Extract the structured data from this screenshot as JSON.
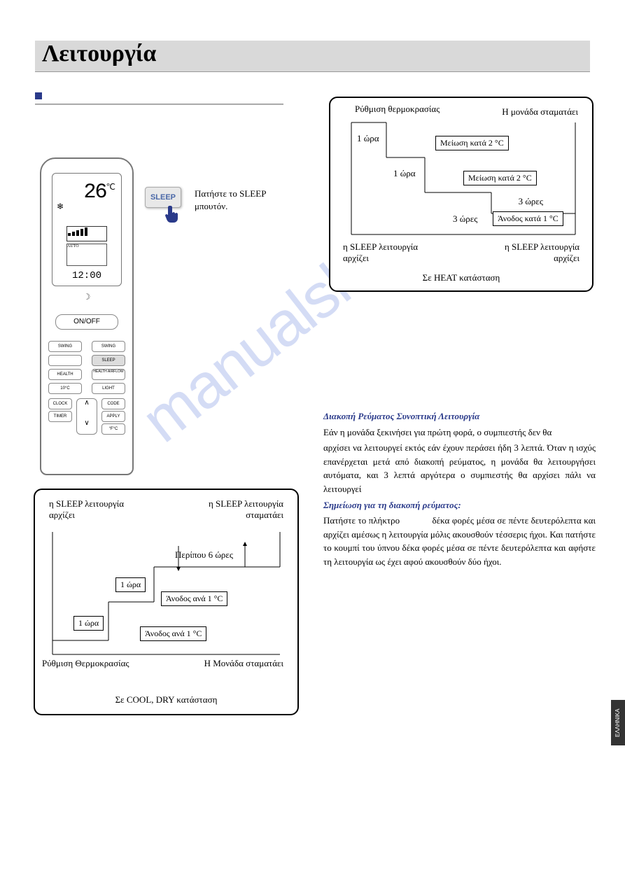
{
  "header": {
    "title": "Λειτουργία"
  },
  "remote": {
    "temp": "26",
    "temp_unit": "℃",
    "clock": "12:00",
    "onoff": "ON/OFF",
    "buttons": {
      "swing_l": "SWING",
      "swing_r": "SWING",
      "blank": "",
      "sleep": "SLEEP",
      "health": "HEALTH",
      "airflow": "HEALTH AIRFLOW",
      "tenc": "10°C",
      "light": "LIGHT",
      "clock": "CLOCK",
      "code": "CODE",
      "timer": "TIMER",
      "apply": "APPLY",
      "deg": "°F°C"
    }
  },
  "sleep_button": {
    "label": "SLEEP",
    "instruction": "Πατήστε το SLEEP μπουτόν."
  },
  "diagram_heat": {
    "temp_setting": "Ρύθμιση θερμοκρασίας",
    "unit_stops": "Η μονάδα σταματάει",
    "h1": "1 ώρα",
    "h2": "1 ώρα",
    "h3": "3 ώρες",
    "h3b": "3 ώρες",
    "dec1": "Μείωση κατά 2 °C",
    "dec2": "Μείωση κατά 2 °C",
    "inc": "Άνοδος κατά 1 °C",
    "sleep_start_l": "η SLEEP λειτουργία αρχίζει",
    "sleep_start_r": "η SLEEP λειτουργία αρχίζει",
    "mode": "Σε HEAT κατάσταση"
  },
  "diagram_cool": {
    "sleep_start": "η SLEEP λειτουργία αρχίζει",
    "sleep_stop": "η SLEEP λειτουργία σταματάει",
    "approx6": "Περίπου 6 ώρες",
    "h1": "1 ώρα",
    "h2": "1 ώρα",
    "inc1": "Άνοδος ανά 1 °C",
    "inc2": "Άνοδος ανά 1 °C",
    "temp_setting": "Ρύθμιση Θερμοκρασίας",
    "unit_stops": "Η Μονάδα σταματάει",
    "mode": "Σε COOL, DRY κατάσταση"
  },
  "text": {
    "power_h": "Διακοπή Ρεύματος Συνοπτική Λειτουργία",
    "p1": "Εάν η μονάδα ξεκινήσει για πρώτη φορά, ο συμπιεστής δεν θα",
    "p2": "αρχίσει να λειτουργεί εκτός εάν έχουν περάσει ήδη 3 λεπτά. Όταν η ισχύς επανέρχεται μετά από διακοπή ρεύματος, η μονάδα θα λειτουργήσει αυτόματα, και 3 λεπτά αργότερα ο συμπιεστής θα αρχίσει πάλι να λειτουργεί",
    "note_h": "Σημείωση για τη διακοπή ρεύματος:",
    "note_p": "Πατήστε το πλήκτρο             δέκα φορές μέσα σε πέντε δευτερόλεπτα και αρχίζει αμέσως η λειτουργία μόλις ακουσθούν τέσσερις ήχοι. Και πατήστε το κουμπί του ύπνου δέκα φορές μέσα σε πέντε δευτερόλεπτα και αφήστε τη λειτουργία ως έχει αφού ακουσθούν δύο ήχοι."
  },
  "langtab": "ΕΛΛΗΝΙΚΑ",
  "watermark": "manualshive.com"
}
